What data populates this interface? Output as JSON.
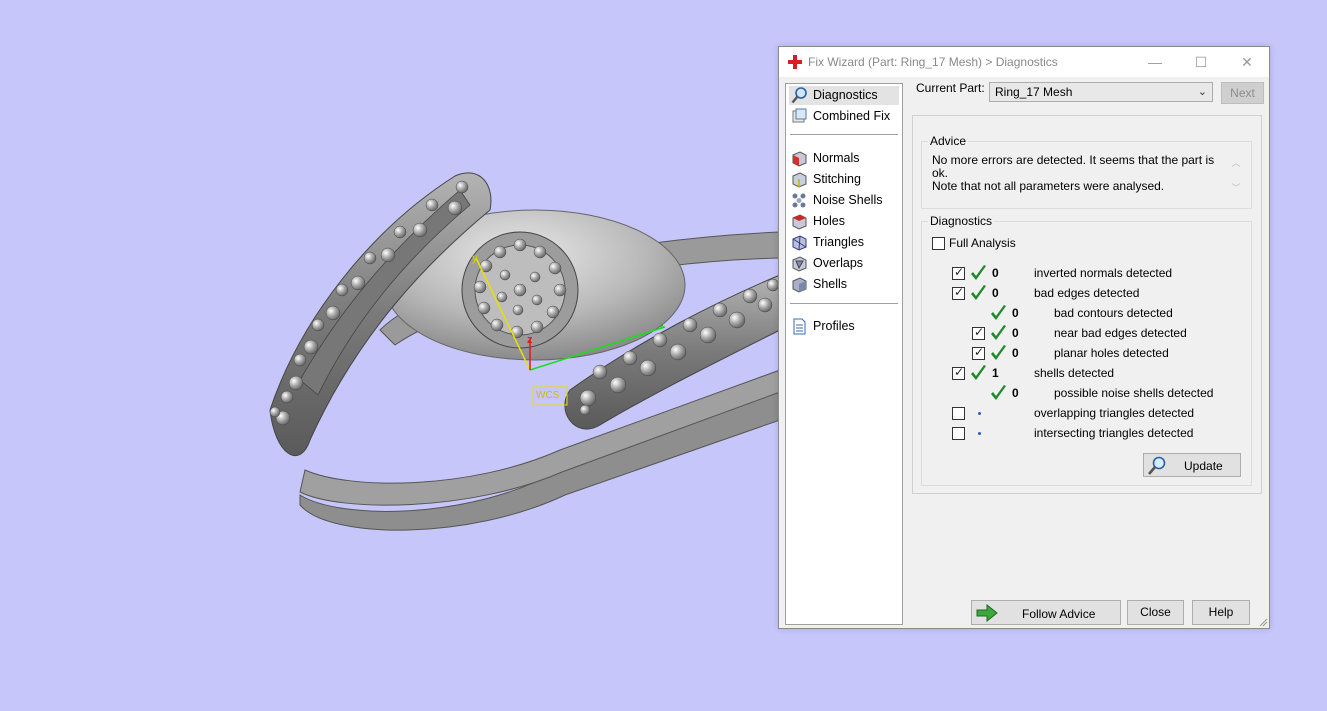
{
  "window": {
    "title": "Fix Wizard (Part: Ring_17 Mesh) > Diagnostics",
    "minimize": "—",
    "maximize": "☐",
    "close": "✕"
  },
  "nav": {
    "items": [
      {
        "label": "Diagnostics",
        "icon": "magnifier-icon",
        "selected": true
      },
      {
        "label": "Combined Fix",
        "icon": "combined-fix-icon"
      },
      {
        "label": "Normals",
        "icon": "normals-icon"
      },
      {
        "label": "Stitching",
        "icon": "stitching-icon"
      },
      {
        "label": "Noise Shells",
        "icon": "noise-shells-icon"
      },
      {
        "label": "Holes",
        "icon": "holes-icon"
      },
      {
        "label": "Triangles",
        "icon": "triangles-icon"
      },
      {
        "label": "Overlaps",
        "icon": "overlaps-icon"
      },
      {
        "label": "Shells",
        "icon": "shells-icon"
      },
      {
        "label": "Profiles",
        "icon": "profiles-icon"
      }
    ]
  },
  "current_part": {
    "label": "Current Part:",
    "value": "Ring_17 Mesh",
    "next_label": "Next"
  },
  "advice": {
    "title": "Advice",
    "line1": "No more errors are detected. It seems that the part is ok.",
    "line2": "Note that not all parameters were analysed."
  },
  "diagnostics": {
    "title": "Diagnostics",
    "full_analysis_label": "Full Analysis",
    "full_analysis_checked": false,
    "rows": [
      {
        "checkbox": true,
        "checked": true,
        "status": "ok",
        "count": "0",
        "label": "inverted normals detected",
        "indent": 0
      },
      {
        "checkbox": true,
        "checked": true,
        "status": "ok",
        "count": "0",
        "label": "bad edges detected",
        "indent": 0
      },
      {
        "checkbox": false,
        "checked": false,
        "status": "ok",
        "count": "0",
        "label": "bad contours detected",
        "indent": 1
      },
      {
        "checkbox": true,
        "checked": true,
        "status": "ok",
        "count": "0",
        "label": "near bad edges detected",
        "indent": 1
      },
      {
        "checkbox": true,
        "checked": true,
        "status": "ok",
        "count": "0",
        "label": "planar holes detected",
        "indent": 1
      },
      {
        "checkbox": true,
        "checked": true,
        "status": "ok",
        "count": "1",
        "label": "shells detected",
        "indent": 0
      },
      {
        "checkbox": false,
        "checked": false,
        "status": "ok",
        "count": "0",
        "label": "possible noise shells detected",
        "indent": 1
      },
      {
        "checkbox": true,
        "checked": false,
        "status": "pending",
        "count": "",
        "label": "overlapping triangles detected",
        "indent": 0
      },
      {
        "checkbox": true,
        "checked": false,
        "status": "pending",
        "count": "",
        "label": "intersecting triangles detected",
        "indent": 0
      }
    ],
    "update_label": "Update"
  },
  "footer": {
    "follow_advice_label": "Follow Advice",
    "close_label": "Close",
    "help_label": "Help"
  },
  "viewport": {
    "wcs_label": "WCS",
    "axis_y": "y",
    "axis_z": "z",
    "axis_x": "x",
    "background_color": "#c6c6fa"
  }
}
